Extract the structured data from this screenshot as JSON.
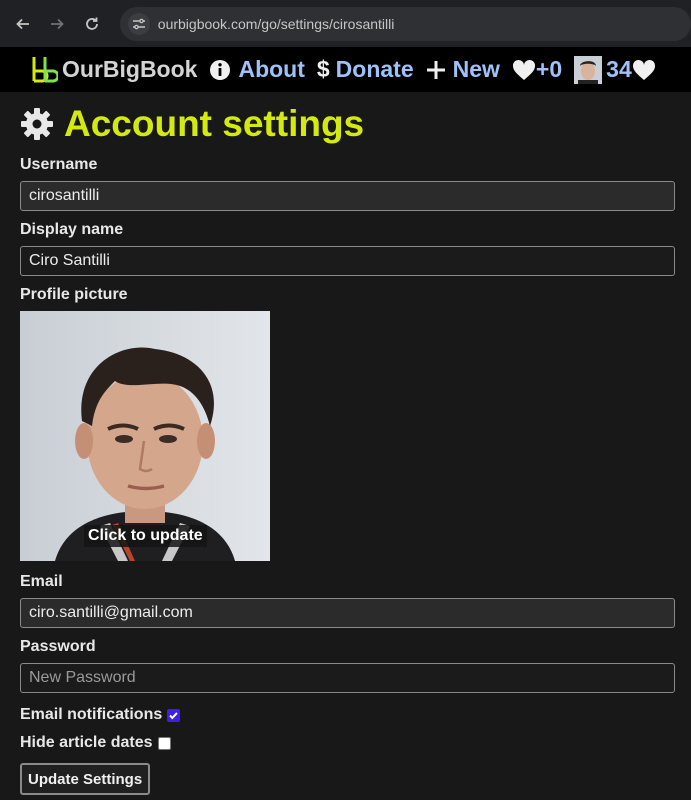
{
  "browser": {
    "url": "ourbigbook.com/go/settings/cirosantilli"
  },
  "topbar": {
    "brand": "OurBigBook",
    "about": "About",
    "donate_symbol": "$",
    "donate": "Donate",
    "new": "New",
    "likes_received": "+0",
    "score": "34"
  },
  "page": {
    "title": "Account settings"
  },
  "form": {
    "username_label": "Username",
    "username_value": "cirosantilli",
    "display_name_label": "Display name",
    "display_name_value": "Ciro Santilli",
    "profile_picture_label": "Profile picture",
    "click_to_update": "Click to update",
    "email_label": "Email",
    "email_value": "ciro.santilli@gmail.com",
    "password_label": "Password",
    "password_placeholder": "New Password",
    "email_notifications_label": "Email notifications",
    "email_notifications_checked": true,
    "hide_article_dates_label": "Hide article dates",
    "hide_article_dates_checked": false,
    "submit_label": "Update Settings"
  },
  "colors": {
    "title": "#d4ea0c",
    "link": "#9ec2f7",
    "background": "#181818",
    "checkbox_checked": "#3d1eea"
  }
}
